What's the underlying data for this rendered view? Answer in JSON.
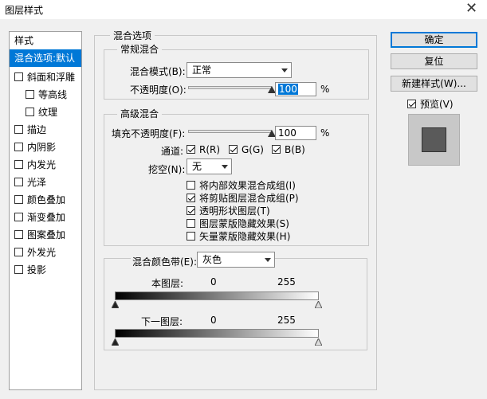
{
  "window": {
    "title": "图层样式",
    "close_glyph": "✕"
  },
  "style_list": [
    {
      "label": "样式",
      "checkbox": false,
      "checked": false,
      "selected": false,
      "indent": false
    },
    {
      "label": "混合选项:默认",
      "checkbox": false,
      "checked": false,
      "selected": true,
      "indent": false
    },
    {
      "label": "斜面和浮雕",
      "checkbox": true,
      "checked": false,
      "selected": false,
      "indent": false
    },
    {
      "label": "等高线",
      "checkbox": true,
      "checked": false,
      "selected": false,
      "indent": true
    },
    {
      "label": "纹理",
      "checkbox": true,
      "checked": false,
      "selected": false,
      "indent": true
    },
    {
      "label": "描边",
      "checkbox": true,
      "checked": false,
      "selected": false,
      "indent": false
    },
    {
      "label": "内阴影",
      "checkbox": true,
      "checked": false,
      "selected": false,
      "indent": false
    },
    {
      "label": "内发光",
      "checkbox": true,
      "checked": false,
      "selected": false,
      "indent": false
    },
    {
      "label": "光泽",
      "checkbox": true,
      "checked": false,
      "selected": false,
      "indent": false
    },
    {
      "label": "颜色叠加",
      "checkbox": true,
      "checked": false,
      "selected": false,
      "indent": false
    },
    {
      "label": "渐变叠加",
      "checkbox": true,
      "checked": false,
      "selected": false,
      "indent": false
    },
    {
      "label": "图案叠加",
      "checkbox": true,
      "checked": false,
      "selected": false,
      "indent": false
    },
    {
      "label": "外发光",
      "checkbox": true,
      "checked": false,
      "selected": false,
      "indent": false
    },
    {
      "label": "投影",
      "checkbox": true,
      "checked": false,
      "selected": false,
      "indent": false
    }
  ],
  "blend_options": {
    "title": "混合选项",
    "general": {
      "title": "常规混合",
      "mode_label": "混合模式(B):",
      "mode_value": "正常",
      "opacity_label": "不透明度(O):",
      "opacity_value": "100",
      "opacity_fraction": 1.0,
      "percent": "%"
    },
    "advanced": {
      "title": "高级混合",
      "fill_label": "填充不透明度(F):",
      "fill_value": "100",
      "fill_fraction": 1.0,
      "percent": "%",
      "channels_label": "通道:",
      "channel_r": "R(R)",
      "channel_g": "G(G)",
      "channel_b": "B(B)",
      "knockout_label": "挖空(N):",
      "knockout_value": "无",
      "options": [
        {
          "label": "将内部效果混合成组(I)",
          "checked": false
        },
        {
          "label": "将剪贴图层混合成组(P)",
          "checked": true
        },
        {
          "label": "透明形状图层(T)",
          "checked": true
        },
        {
          "label": "图层蒙版隐藏效果(S)",
          "checked": false
        },
        {
          "label": "矢量蒙版隐藏效果(H)",
          "checked": false
        }
      ]
    },
    "blend_if": {
      "label": "混合颜色带(E):",
      "value": "灰色",
      "this_layer_label": "本图层:",
      "this_layer_min": "0",
      "this_layer_max": "255",
      "underlying_label": "下一图层:",
      "underlying_min": "0",
      "underlying_max": "255"
    }
  },
  "buttons": {
    "ok": "确定",
    "reset": "复位",
    "new_style": "新建样式(W)...",
    "preview": "预览(V)"
  },
  "colors": {
    "accent": "#0078d7",
    "preview_swatch": "#5a5a5a"
  }
}
